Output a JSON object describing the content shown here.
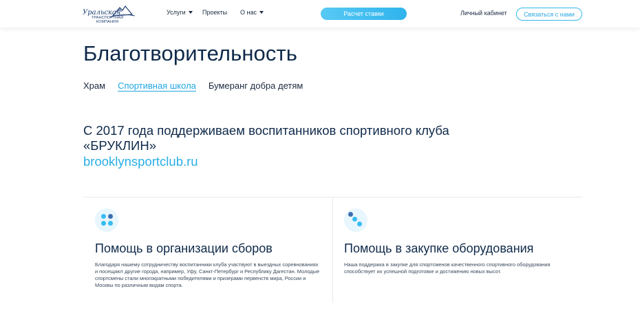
{
  "header": {
    "logo": {
      "line1": "Уральская",
      "line2": "ТРАНСПОРТНАЯ КОМПАНИЯ"
    },
    "nav": [
      {
        "label": "Услуги",
        "has_dropdown": true
      },
      {
        "label": "Проекты",
        "has_dropdown": false
      },
      {
        "label": "О нас",
        "has_dropdown": true
      }
    ],
    "rate_button": "Расчет ставки",
    "cabinet_link": "Личный кабинет",
    "contact_button": "Связаться с нами"
  },
  "page": {
    "title": "Благотворительность",
    "tabs": [
      {
        "label": "Храм",
        "active": false
      },
      {
        "label": "Спортивная школа",
        "active": true
      },
      {
        "label": "Бумеранг добра детям",
        "active": false
      }
    ],
    "intro": "С 2017 года поддерживаем воспитанников спортивного клуба «БРУКЛИН»",
    "link": "brooklynsportclub.ru"
  },
  "cards": [
    {
      "icon": "four-dots-icon",
      "title": "Помощь в организации сборов",
      "text": "Благодаря нашему сотрудничеству воспитанники клуба участвуют в выездных соревнованиях и посещают другие города, например, Уфу, Санкт-Петербург и Республику Дагестан. Молодые спортсмены стали многократными победителями и призерами первенств мира, России и Москвы по различным видам спорта."
    },
    {
      "icon": "diagonal-dots-icon",
      "title": "Помощь в закупке оборудования",
      "text": "Наша поддержка в закупке для спортсменов качественного спортивного оборудования способствует их успешной подготовке и достижению новых высот."
    }
  ],
  "colors": {
    "accent": "#2aaee6",
    "dark_text": "#0f2a4a",
    "dot_dark": "#3d6fae",
    "dot_light": "#36bdf0",
    "icon_bg": "#e8f6fd"
  }
}
